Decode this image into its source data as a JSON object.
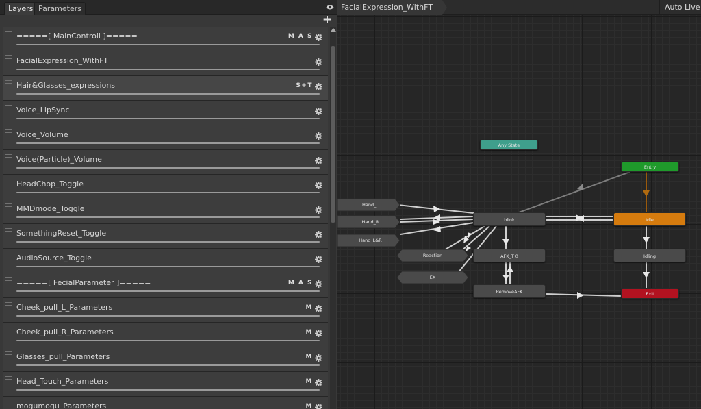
{
  "tabs": {
    "layers": "Layers",
    "parameters": "Parameters"
  },
  "add_label": "+",
  "layers": [
    {
      "name": "=====[ MainControll ]=====",
      "badge": "M A S"
    },
    {
      "name": "FacialExpression_WithFT",
      "badge": ""
    },
    {
      "name": "Hair&Glasses_expressions",
      "badge": "S+T",
      "selected": true
    },
    {
      "name": "Voice_LipSync",
      "badge": ""
    },
    {
      "name": "Voice_Volume",
      "badge": ""
    },
    {
      "name": "Voice(Particle)_Volume",
      "badge": ""
    },
    {
      "name": "HeadChop_Toggle",
      "badge": ""
    },
    {
      "name": "MMDmode_Toggle",
      "badge": ""
    },
    {
      "name": "SomethingReset_Toggle",
      "badge": ""
    },
    {
      "name": "AudioSource_Toggle",
      "badge": ""
    },
    {
      "name": "=====[ FecialParameter ]=====",
      "badge": "M A S"
    },
    {
      "name": "Cheek_pull_L_Parameters",
      "badge": "M"
    },
    {
      "name": "Cheek_pull_R_Parameters",
      "badge": "M"
    },
    {
      "name": "Glasses_pull_Parameters",
      "badge": "M"
    },
    {
      "name": "Head_Touch_Parameters",
      "badge": "M"
    },
    {
      "name": "mogumogu_Parameters",
      "badge": "M"
    }
  ],
  "graph": {
    "breadcrumb": "FacialExpression_WithFT",
    "auto_live_label": "Auto Live L",
    "states": {
      "any_state": "Any State",
      "entry": "Entry",
      "exit": "Exit",
      "idle": "Idle",
      "blink": "blink",
      "afk": "AFK_T 0",
      "idling": "Idling",
      "remove_afk": "RemoveAFK"
    },
    "subs": {
      "hand_l": "Hand_L",
      "hand_r": "Hand_R",
      "hand_lr": "Hand_L&R",
      "reaction": "Reaction",
      "ex": "EX"
    }
  },
  "colors": {
    "any_state": "#3f9f8c",
    "entry": "#1f9a2b",
    "exit": "#b21220",
    "default_state": "#d57b0e",
    "state": "#4a4a4a"
  },
  "icons": {
    "visibility": "eye-icon",
    "settings": "gear-icon",
    "add": "plus-icon"
  }
}
